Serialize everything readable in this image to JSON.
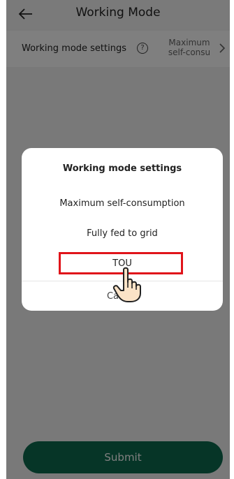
{
  "header": {
    "title": "Working Mode"
  },
  "settings_row": {
    "label": "Working mode settings",
    "value_line1": "Maximum",
    "value_line2": "self-consu"
  },
  "dialog": {
    "title": "Working mode settings",
    "options": [
      {
        "label": "Maximum self-consumption"
      },
      {
        "label": "Fully fed to grid"
      },
      {
        "label": "TOU"
      }
    ],
    "cancel_label": "Cancel"
  },
  "submit": {
    "label": "Submit"
  },
  "icons": {
    "back": "arrow-left-icon",
    "help": "question-circle-icon",
    "chevron": "chevron-right-icon",
    "pointer": "hand-pointer-icon"
  },
  "colors": {
    "primary": "#0d6b4f",
    "highlight": "#e0141a"
  }
}
